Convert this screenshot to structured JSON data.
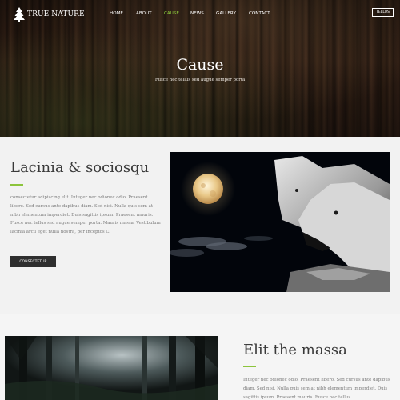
{
  "header": {
    "logo_text": "TRUE NATURE",
    "nav": [
      "HOME",
      "ABOUT",
      "CAUSE",
      "NEWS",
      "GALLERY",
      "CONTACT"
    ],
    "active_nav": "CAUSE",
    "tell_button": "TELLUS"
  },
  "hero": {
    "title": "Cause",
    "subtitle": "Fusce nec tellus sed augue semper porta"
  },
  "section1": {
    "title": "Lacinia & sociosqu",
    "body": "consectetur adipiscing elit. Integer nec odionec odio. Praesent libero. Sed cursus ante dapibus diam. Sed nisi. Nulla quis sem at nibh elementum imperdiet. Duis sagittis ipsum. Praesent mauris. Fusce nec tellus sed augue semper porta. Mauris massa. Vestibulum lacinia arcu eget nulla nostra, per inceptos C.",
    "button": "CONSECTETUR"
  },
  "section2": {
    "title": "Elit the massa",
    "body": "Integer nec odionec odio. Praesent libero. Sed cursus ante dapibus diam. Sed nisi. Nulla quis sem at nibh elementum imperdiet. Duis sagittis ipsum. Praesent mauris. Fusce nec tellus"
  },
  "colors": {
    "accent": "#8cc43c",
    "active_nav": "#8fcf3c",
    "button_bg": "#2f2f2f"
  }
}
